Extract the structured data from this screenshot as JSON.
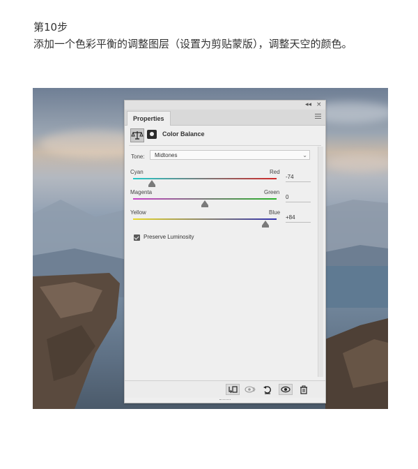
{
  "article": {
    "step_title": "第10步",
    "step_description": "添加一个色彩平衡的调整图层（设置为剪贴蒙版），调整天空的颜色。"
  },
  "panel": {
    "topbar_collapse": "◂◂",
    "topbar_close": "×",
    "tab_label": "Properties",
    "header_title": "Color Balance",
    "tone_label": "Tone:",
    "tone_value": "Midtones",
    "sliders": [
      {
        "left_label": "Cyan",
        "right_label": "Red",
        "value": "-74",
        "level": -74,
        "min": -100,
        "max": 100,
        "left_color": "#22c8c8",
        "right_color": "#d02828"
      },
      {
        "left_label": "Magenta",
        "right_label": "Green",
        "value": "0",
        "level": 0,
        "min": -100,
        "max": 100,
        "left_color": "#c840c8",
        "right_color": "#28b428"
      },
      {
        "left_label": "Yellow",
        "right_label": "Blue",
        "value": "+84",
        "level": 84,
        "min": -100,
        "max": 100,
        "left_color": "#e6d828",
        "right_color": "#3030b0"
      }
    ],
    "preserve_luminosity_label": "Preserve Luminosity",
    "preserve_luminosity_checked": true,
    "bottom_icons": [
      "clip-to-layer-icon",
      "view-previous-icon",
      "reset-icon",
      "visibility-eye-icon",
      "trash-icon"
    ]
  }
}
